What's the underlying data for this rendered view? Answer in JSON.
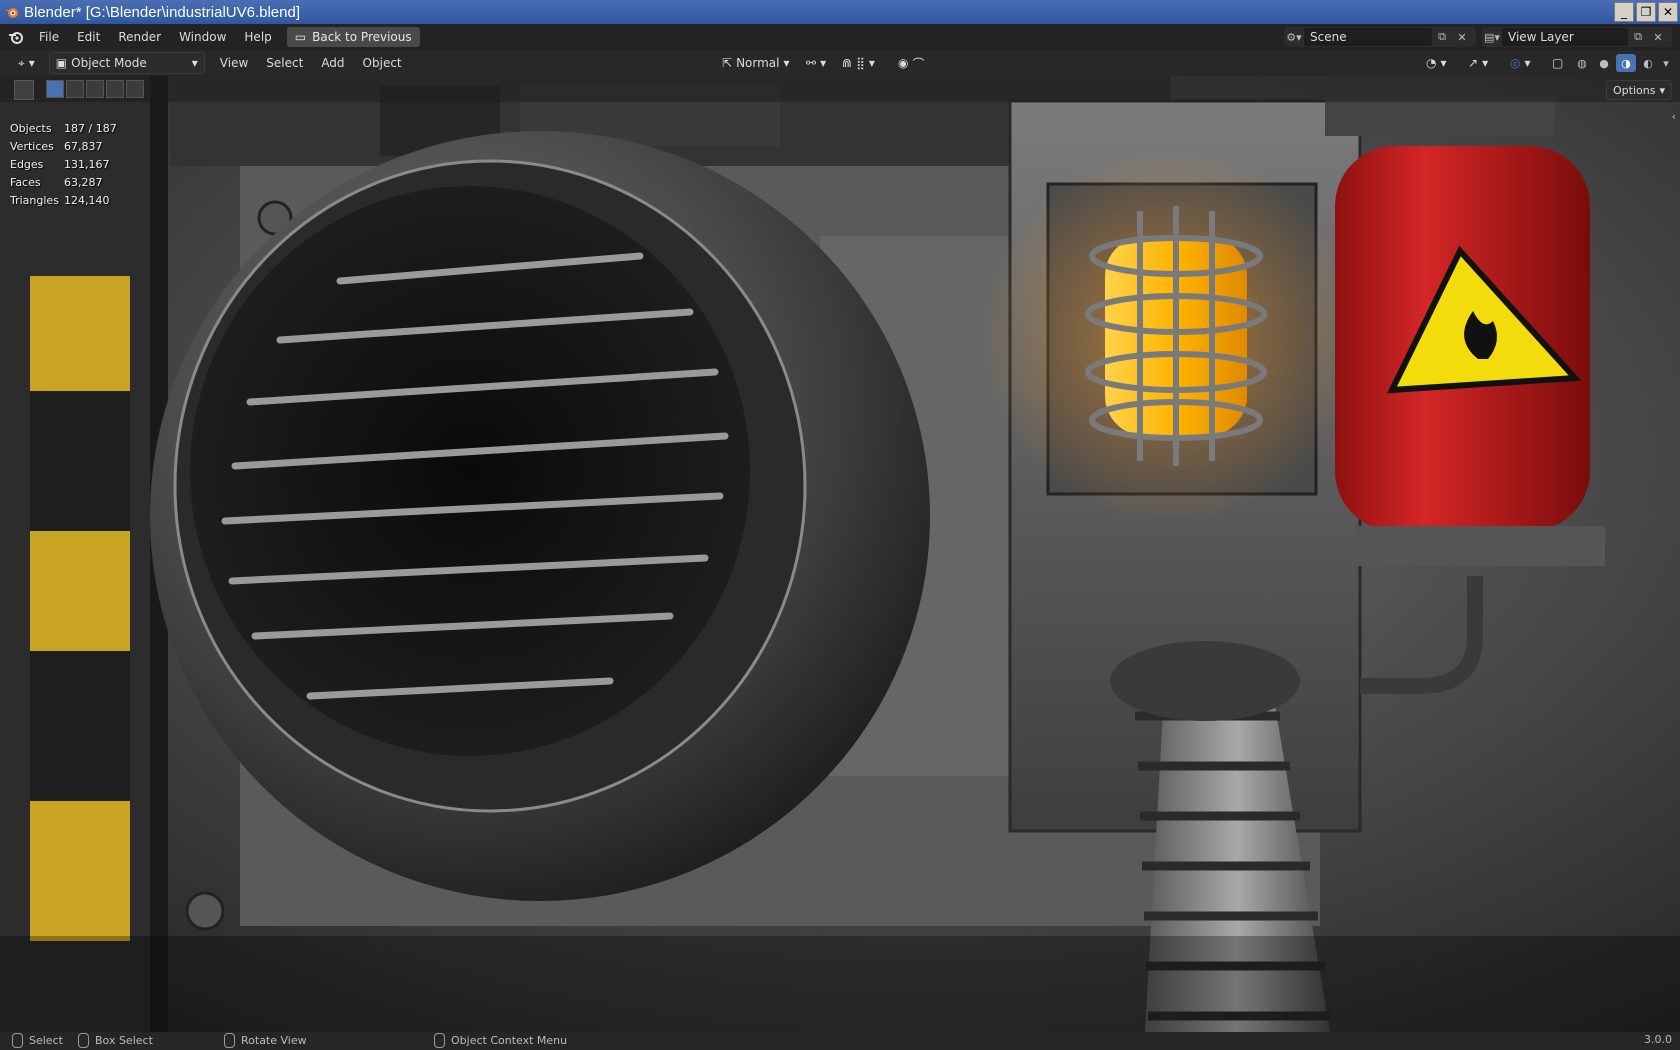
{
  "window": {
    "title": "Blender* [G:\\Blender\\industrialUV6.blend]",
    "minimize": "_",
    "restore": "❐",
    "close": "✕"
  },
  "menu": {
    "items": [
      "File",
      "Edit",
      "Render",
      "Window",
      "Help"
    ],
    "back_button": "Back to Previous",
    "scene_label": "Scene",
    "view_layer_label": "View Layer"
  },
  "header": {
    "mode": "Object Mode",
    "menus": [
      "View",
      "Select",
      "Add",
      "Object"
    ],
    "orientation": "Normal",
    "options_label": "Options"
  },
  "stats": [
    {
      "label": "Objects",
      "value": "187 / 187"
    },
    {
      "label": "Vertices",
      "value": "67,837"
    },
    {
      "label": "Edges",
      "value": "131,167"
    },
    {
      "label": "Faces",
      "value": "63,287"
    },
    {
      "label": "Triangles",
      "value": "124,140"
    }
  ],
  "statusbar": {
    "select": "Select",
    "box_select": "Box Select",
    "rotate_view": "Rotate View",
    "context_menu": "Object Context Menu",
    "version": "3.0.0"
  },
  "colors": {
    "accent": "#4772b3",
    "lamp": "#ffb300",
    "tank": "#c41e1e",
    "warning": "#f2dc0c"
  }
}
